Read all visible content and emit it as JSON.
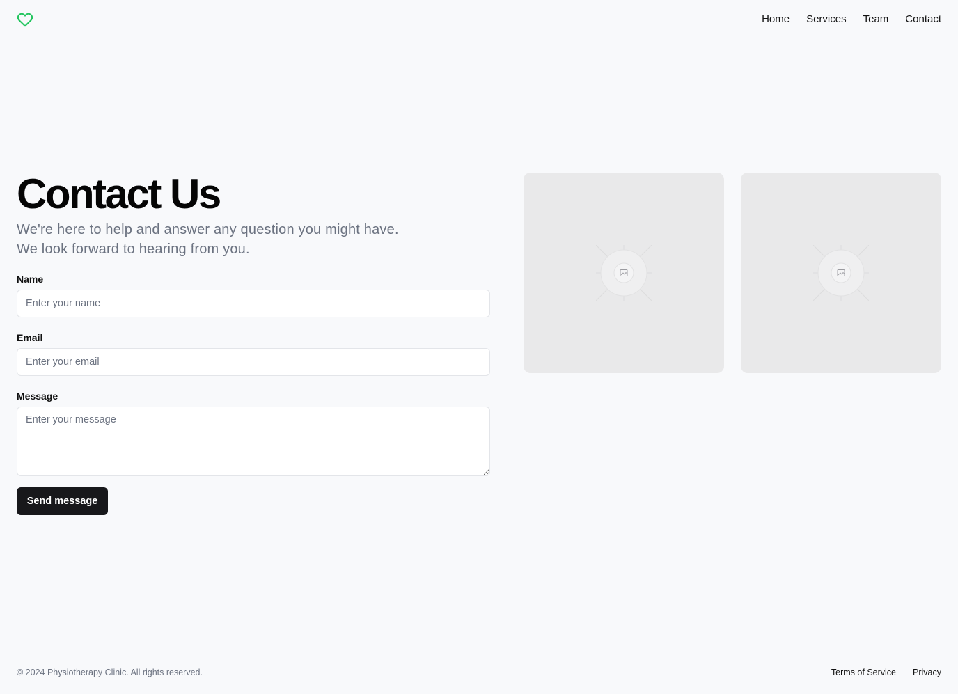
{
  "header": {
    "logo_icon": "heart-outline-icon",
    "logo_color": "#22c55e",
    "nav": {
      "home": "Home",
      "services": "Services",
      "team": "Team",
      "contact": "Contact"
    }
  },
  "main": {
    "title": "Contact Us",
    "subtitle_line1": "We're here to help and answer any question you might have.",
    "subtitle_line2": "We look forward to hearing from you.",
    "form": {
      "name_label": "Name",
      "name_placeholder": "Enter your name",
      "email_label": "Email",
      "email_placeholder": "Enter your email",
      "message_label": "Message",
      "message_placeholder": "Enter your message",
      "submit_label": "Send message"
    },
    "images": [
      "image-placeholder-icon",
      "image-placeholder-icon"
    ]
  },
  "footer": {
    "copyright": "© 2024 Physiotherapy Clinic. All rights reserved.",
    "terms": "Terms of Service",
    "privacy": "Privacy"
  }
}
